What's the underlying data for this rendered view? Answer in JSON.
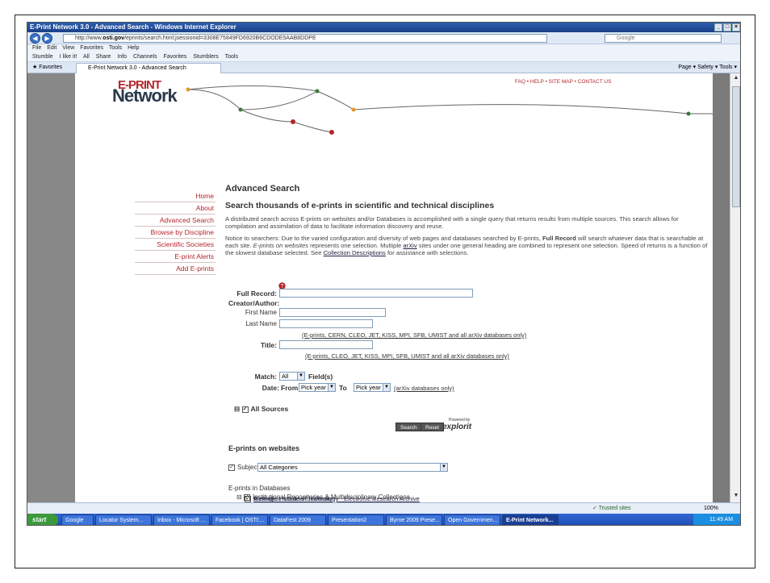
{
  "window": {
    "title": "E-Print Network 3.0 - Advanced Search - Windows Internet Explorer",
    "url_prefix": "http://www.",
    "url_domain": "osti.gov",
    "url_rest": "/eprints/search.html;jsessionid=3308E75849FD6920B6CDODE5AAB8DDPE",
    "search_placeholder": "Google",
    "menu": "File  Edit  View  Favorites  Tools  Help",
    "links_items": [
      "Stumble",
      "I like it!",
      "All",
      "Share",
      "Info",
      "Channels",
      "Favorites",
      "Stumblers",
      "Tools"
    ],
    "favorites_label": "Favorites",
    "tab_label": "E-Print Network 3.0 - Advanced Search",
    "cmd_items": "Page ▾  Safety ▾  Tools ▾",
    "status_zone": "Trusted sites",
    "status_zoom": "100%"
  },
  "taskbar": {
    "start": "start",
    "tasks": [
      "Google",
      "Locator System...",
      "Inbox - Microsoft ...",
      "Facebook | OSTI:...",
      "DataFest 2009",
      "Presentation2",
      "Byrne 2009 Prese...",
      "Open Governmen...",
      "E-Print Network..."
    ],
    "clock": "11:49 AM"
  },
  "site": {
    "logo_top": "E-PRINT",
    "logo_bottom": "Network",
    "header_links": "FAQ • HELP • SITE MAP • CONTACT US",
    "nav": [
      "Home",
      "About",
      "Advanced Search",
      "Browse by Discipline",
      "Scientific Societies",
      "E-print Alerts",
      "Add E-prints"
    ]
  },
  "content": {
    "heading": "Advanced Search",
    "subheading": "Search thousands of e-prints in scientific and technical disciplines",
    "para1": "A distributed search across E-prints on websites and/or Databases is accomplished with a single query that returns results from multiple sources. This search allows for compilation and assimilation of data to facilitate information discovery and reuse.",
    "para2_a": "Notice to searchers: Due to the varied configuration and diversity of web pages and databases searched by E-prints, ",
    "para2_b": "Full Record",
    "para2_c": " will search whatever data that is searchable at each site. ",
    "para2_d": "E-prints on websites",
    "para2_e": " represents one selection. Multiple ",
    "para2_f": "arXiv",
    "para2_g": " sites under one general heading are combined to represent one selection. Speed of returns is a function of the slowest database selected. See ",
    "para2_h": "Collection Descriptions",
    "para2_i": " for assistance with selections.",
    "full_record_label": "Full Record:",
    "creator_label": "Creator/Author:",
    "first_name_label": "First Name",
    "last_name_label": "Last Name",
    "author_note": "(E-prints, CERN, CLEO, JET, KISS, MPI, SFB, UMIST and all arXiv databases only)",
    "title_label": "Title:",
    "title_note": "(E-prints, CLEO, JET, KISS, MPI, SFB, UMIST and all arXiv databases only)",
    "match_label": "Match:",
    "match_value": "All",
    "fields_label": "Field(s)",
    "date_label": "Date:",
    "from_label": "From",
    "from_value": "Pick year",
    "to_label": "To",
    "to_value": "Pick year",
    "date_note": "(arXiv databases only)",
    "all_sources": "All Sources",
    "search_button": "Search",
    "reset_button": "Reset",
    "powered_by": "Powered by",
    "explorit": "explorit",
    "section_websites": "E-prints on websites",
    "subject_label": "Subject",
    "subject_value": "All Categories",
    "in_databases": "E-prints in Databases",
    "repo_group": "Institutional Repositories & Multidisciplinary Collections",
    "repo_items": [
      "Australian National University",
      "Blekinge Institute of Technology - Electronic Research Archive"
    ]
  }
}
